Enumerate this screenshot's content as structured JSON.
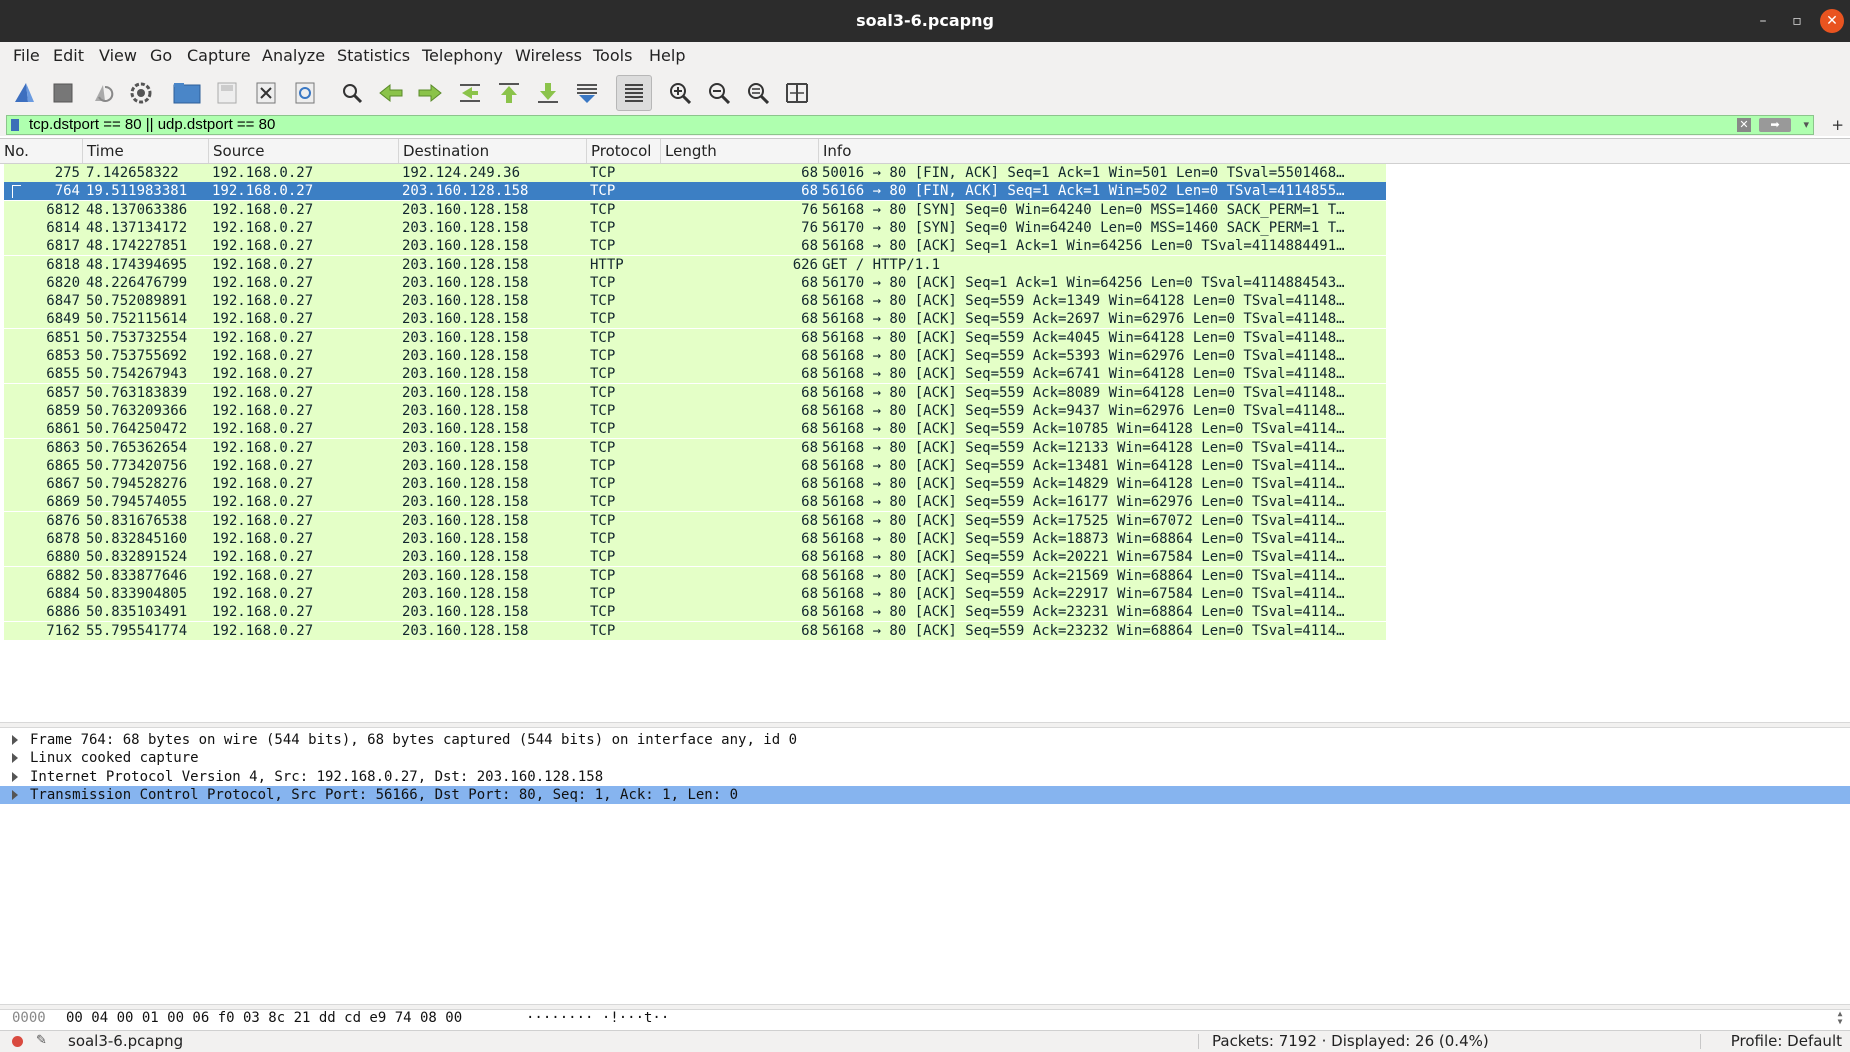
{
  "window": {
    "title": "soal3-6.pcapng",
    "minimize_glyph": "–",
    "maximize_glyph": "▫",
    "close_glyph": "✕"
  },
  "menu": [
    "File",
    "Edit",
    "View",
    "Go",
    "Capture",
    "Analyze",
    "Statistics",
    "Telephony",
    "Wireless",
    "Tools",
    "Help"
  ],
  "toolbar": {
    "icons": [
      "shark-start-icon",
      "stop-capture-icon",
      "restart-capture-icon",
      "capture-options-icon",
      "open-file-icon",
      "save-file-icon",
      "close-file-icon",
      "reload-file-icon",
      "find-packet-icon",
      "go-back-icon",
      "go-forward-icon",
      "go-to-packet-icon",
      "first-packet-icon",
      "last-packet-icon",
      "autoscroll-icon",
      "colorize-icon",
      "zoom-in-icon",
      "zoom-out-icon",
      "normal-size-icon",
      "resize-columns-icon"
    ]
  },
  "filter": {
    "value": "tcp.dstport == 80 || udp.dstport == 80",
    "plus": "+",
    "clear_glyph": "✕",
    "apply_glyph": "➡",
    "dropdown_glyph": "▾"
  },
  "columns": {
    "no": "No.",
    "time": "Time",
    "source": "Source",
    "destination": "Destination",
    "protocol": "Protocol",
    "length": "Length",
    "info": "Info"
  },
  "packets": [
    {
      "no": "275",
      "time": "7.142658322",
      "src": "192.168.0.27",
      "dst": "192.124.249.36",
      "proto": "TCP",
      "len": "68",
      "info": "50016 → 80 [FIN, ACK] Seq=1 Ack=1 Win=501 Len=0 TSval=5501468…"
    },
    {
      "no": "764",
      "time": "19.511983381",
      "src": "192.168.0.27",
      "dst": "203.160.128.158",
      "proto": "TCP",
      "len": "68",
      "info": "56166 → 80 [FIN, ACK] Seq=1 Ack=1 Win=502 Len=0 TSval=4114855…",
      "selected": true
    },
    {
      "no": "6812",
      "time": "48.137063386",
      "src": "192.168.0.27",
      "dst": "203.160.128.158",
      "proto": "TCP",
      "len": "76",
      "info": "56168 → 80 [SYN] Seq=0 Win=64240 Len=0 MSS=1460 SACK_PERM=1 T…"
    },
    {
      "no": "6814",
      "time": "48.137134172",
      "src": "192.168.0.27",
      "dst": "203.160.128.158",
      "proto": "TCP",
      "len": "76",
      "info": "56170 → 80 [SYN] Seq=0 Win=64240 Len=0 MSS=1460 SACK_PERM=1 T…"
    },
    {
      "no": "6817",
      "time": "48.174227851",
      "src": "192.168.0.27",
      "dst": "203.160.128.158",
      "proto": "TCP",
      "len": "68",
      "info": "56168 → 80 [ACK] Seq=1 Ack=1 Win=64256 Len=0 TSval=4114884491…"
    },
    {
      "no": "6818",
      "time": "48.174394695",
      "src": "192.168.0.27",
      "dst": "203.160.128.158",
      "proto": "HTTP",
      "len": "626",
      "info": "GET / HTTP/1.1"
    },
    {
      "no": "6820",
      "time": "48.226476799",
      "src": "192.168.0.27",
      "dst": "203.160.128.158",
      "proto": "TCP",
      "len": "68",
      "info": "56170 → 80 [ACK] Seq=1 Ack=1 Win=64256 Len=0 TSval=4114884543…"
    },
    {
      "no": "6847",
      "time": "50.752089891",
      "src": "192.168.0.27",
      "dst": "203.160.128.158",
      "proto": "TCP",
      "len": "68",
      "info": "56168 → 80 [ACK] Seq=559 Ack=1349 Win=64128 Len=0 TSval=41148…"
    },
    {
      "no": "6849",
      "time": "50.752115614",
      "src": "192.168.0.27",
      "dst": "203.160.128.158",
      "proto": "TCP",
      "len": "68",
      "info": "56168 → 80 [ACK] Seq=559 Ack=2697 Win=62976 Len=0 TSval=41148…"
    },
    {
      "no": "6851",
      "time": "50.753732554",
      "src": "192.168.0.27",
      "dst": "203.160.128.158",
      "proto": "TCP",
      "len": "68",
      "info": "56168 → 80 [ACK] Seq=559 Ack=4045 Win=64128 Len=0 TSval=41148…"
    },
    {
      "no": "6853",
      "time": "50.753755692",
      "src": "192.168.0.27",
      "dst": "203.160.128.158",
      "proto": "TCP",
      "len": "68",
      "info": "56168 → 80 [ACK] Seq=559 Ack=5393 Win=62976 Len=0 TSval=41148…"
    },
    {
      "no": "6855",
      "time": "50.754267943",
      "src": "192.168.0.27",
      "dst": "203.160.128.158",
      "proto": "TCP",
      "len": "68",
      "info": "56168 → 80 [ACK] Seq=559 Ack=6741 Win=64128 Len=0 TSval=41148…"
    },
    {
      "no": "6857",
      "time": "50.763183839",
      "src": "192.168.0.27",
      "dst": "203.160.128.158",
      "proto": "TCP",
      "len": "68",
      "info": "56168 → 80 [ACK] Seq=559 Ack=8089 Win=64128 Len=0 TSval=41148…"
    },
    {
      "no": "6859",
      "time": "50.763209366",
      "src": "192.168.0.27",
      "dst": "203.160.128.158",
      "proto": "TCP",
      "len": "68",
      "info": "56168 → 80 [ACK] Seq=559 Ack=9437 Win=62976 Len=0 TSval=41148…"
    },
    {
      "no": "6861",
      "time": "50.764250472",
      "src": "192.168.0.27",
      "dst": "203.160.128.158",
      "proto": "TCP",
      "len": "68",
      "info": "56168 → 80 [ACK] Seq=559 Ack=10785 Win=64128 Len=0 TSval=4114…"
    },
    {
      "no": "6863",
      "time": "50.765362654",
      "src": "192.168.0.27",
      "dst": "203.160.128.158",
      "proto": "TCP",
      "len": "68",
      "info": "56168 → 80 [ACK] Seq=559 Ack=12133 Win=64128 Len=0 TSval=4114…"
    },
    {
      "no": "6865",
      "time": "50.773420756",
      "src": "192.168.0.27",
      "dst": "203.160.128.158",
      "proto": "TCP",
      "len": "68",
      "info": "56168 → 80 [ACK] Seq=559 Ack=13481 Win=64128 Len=0 TSval=4114…"
    },
    {
      "no": "6867",
      "time": "50.794528276",
      "src": "192.168.0.27",
      "dst": "203.160.128.158",
      "proto": "TCP",
      "len": "68",
      "info": "56168 → 80 [ACK] Seq=559 Ack=14829 Win=64128 Len=0 TSval=4114…"
    },
    {
      "no": "6869",
      "time": "50.794574055",
      "src": "192.168.0.27",
      "dst": "203.160.128.158",
      "proto": "TCP",
      "len": "68",
      "info": "56168 → 80 [ACK] Seq=559 Ack=16177 Win=62976 Len=0 TSval=4114…"
    },
    {
      "no": "6876",
      "time": "50.831676538",
      "src": "192.168.0.27",
      "dst": "203.160.128.158",
      "proto": "TCP",
      "len": "68",
      "info": "56168 → 80 [ACK] Seq=559 Ack=17525 Win=67072 Len=0 TSval=4114…"
    },
    {
      "no": "6878",
      "time": "50.832845160",
      "src": "192.168.0.27",
      "dst": "203.160.128.158",
      "proto": "TCP",
      "len": "68",
      "info": "56168 → 80 [ACK] Seq=559 Ack=18873 Win=68864 Len=0 TSval=4114…"
    },
    {
      "no": "6880",
      "time": "50.832891524",
      "src": "192.168.0.27",
      "dst": "203.160.128.158",
      "proto": "TCP",
      "len": "68",
      "info": "56168 → 80 [ACK] Seq=559 Ack=20221 Win=67584 Len=0 TSval=4114…"
    },
    {
      "no": "6882",
      "time": "50.833877646",
      "src": "192.168.0.27",
      "dst": "203.160.128.158",
      "proto": "TCP",
      "len": "68",
      "info": "56168 → 80 [ACK] Seq=559 Ack=21569 Win=68864 Len=0 TSval=4114…"
    },
    {
      "no": "6884",
      "time": "50.833904805",
      "src": "192.168.0.27",
      "dst": "203.160.128.158",
      "proto": "TCP",
      "len": "68",
      "info": "56168 → 80 [ACK] Seq=559 Ack=22917 Win=67584 Len=0 TSval=4114…"
    },
    {
      "no": "6886",
      "time": "50.835103491",
      "src": "192.168.0.27",
      "dst": "203.160.128.158",
      "proto": "TCP",
      "len": "68",
      "info": "56168 → 80 [ACK] Seq=559 Ack=23231 Win=68864 Len=0 TSval=4114…"
    },
    {
      "no": "7162",
      "time": "55.795541774",
      "src": "192.168.0.27",
      "dst": "203.160.128.158",
      "proto": "TCP",
      "len": "68",
      "info": "56168 → 80 [ACK] Seq=559 Ack=23232 Win=68864 Len=0 TSval=4114…"
    }
  ],
  "details": [
    {
      "text": "Frame 764: 68 bytes on wire (544 bits), 68 bytes captured (544 bits) on interface any, id 0"
    },
    {
      "text": "Linux cooked capture"
    },
    {
      "text": "Internet Protocol Version 4, Src: 192.168.0.27, Dst: 203.160.128.158"
    },
    {
      "text": "Transmission Control Protocol, Src Port: 56166, Dst Port: 80, Seq: 1, Ack: 1, Len: 0",
      "selected": true
    }
  ],
  "bytes": {
    "offset": "0000",
    "hex": "00 04 00 01 00 06 f0 03  8c 21 dd cd e9 74 08 00",
    "ascii": "········ ·!···t··",
    "scroll_up": "▲",
    "scroll_down": "▼"
  },
  "status": {
    "edit_glyph": "✎",
    "file": "soal3-6.pcapng",
    "counts": "Packets: 7192 · Displayed: 26 (0.4%)",
    "profile": "Profile: Default"
  },
  "colors": {
    "row_tcp": "#e4ffc7",
    "row_selected": "#3c7fc4",
    "filter_valid": "#afffaf",
    "detail_selected": "#86b4ef"
  }
}
